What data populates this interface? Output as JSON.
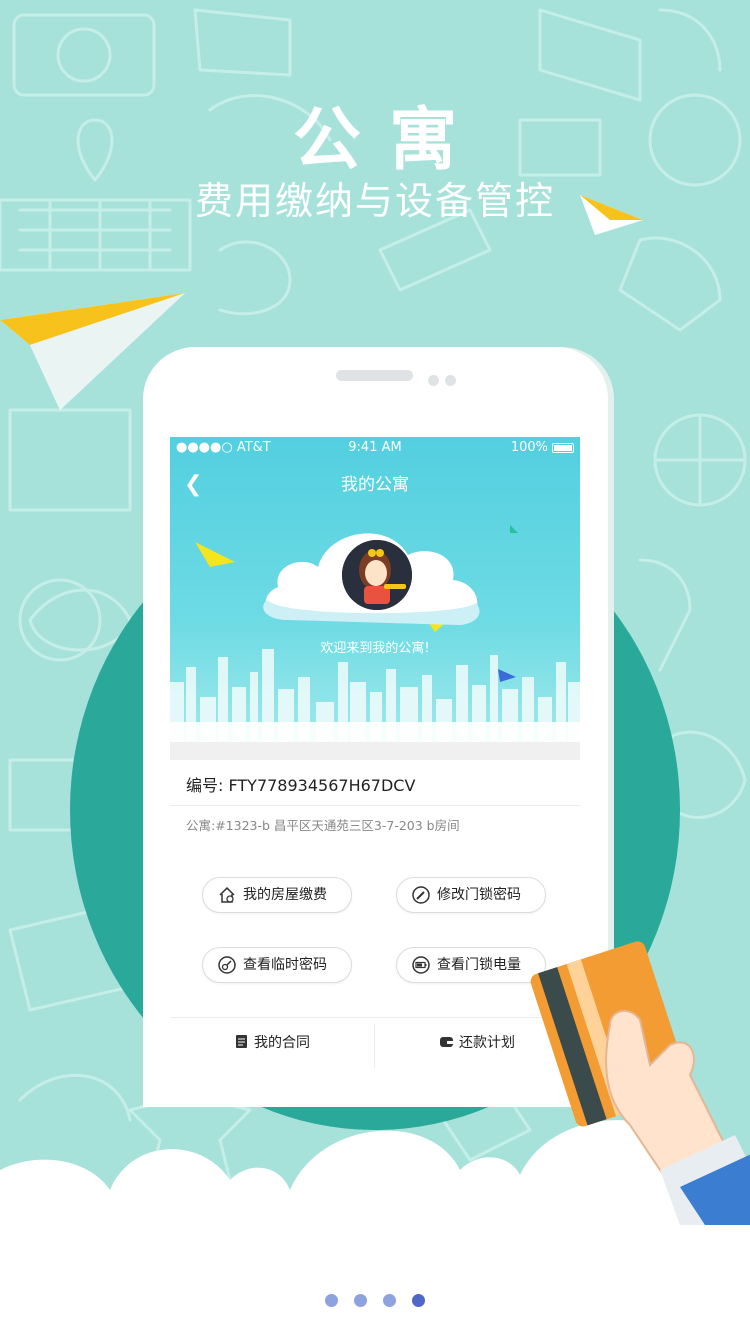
{
  "header": {
    "title": "公寓",
    "subtitle": "费用缴纳与设备管控"
  },
  "phone": {
    "statusbar": {
      "carrier": "●●●●○ AT&T",
      "time": "9:41 AM",
      "battery": "100%"
    },
    "navbar": {
      "back_icon": "chevron-left-icon",
      "title": "我的公寓"
    },
    "hero": {
      "welcome": "欢迎来到我的公寓!"
    },
    "info": {
      "code_label": "编号: FTY778934567H67DCV",
      "address": "公寓:#1323-b 昌平区天通苑三区3-7-203 b房间"
    },
    "actions": [
      {
        "label": "我的房屋缴费",
        "icon": "house-pay-icon"
      },
      {
        "label": "修改门锁密码",
        "icon": "key-edit-icon"
      },
      {
        "label": "查看临时密码",
        "icon": "temp-password-icon"
      },
      {
        "label": "查看门锁电量",
        "icon": "battery-icon"
      }
    ],
    "tabs": [
      {
        "label": "我的合同",
        "icon": "document-icon"
      },
      {
        "label": "还款计划",
        "icon": "wallet-icon"
      }
    ]
  },
  "pager": {
    "count": 4,
    "active": 4
  },
  "colors": {
    "background": "#a6e2da",
    "circle": "#2aa89a",
    "hero_top": "#53cfe0",
    "dot": "#8ea2de",
    "dot_active": "#4f68c8",
    "card_orange": "#f39c33"
  }
}
